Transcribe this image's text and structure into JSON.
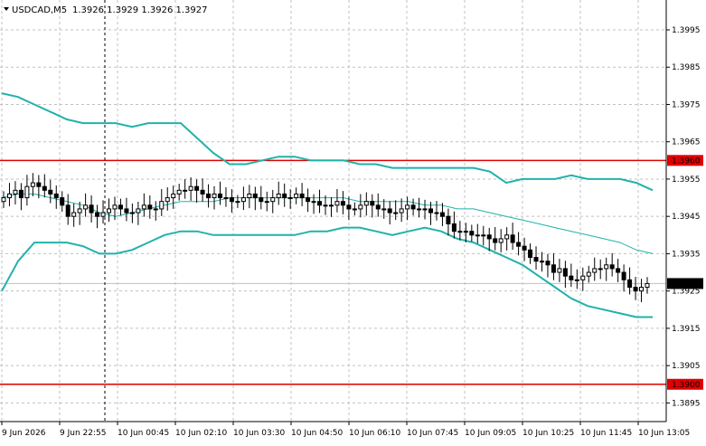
{
  "header": {
    "symbol_label": "USDCAD,M5",
    "ohlc_label": "1.3926 1.3929 1.3926 1.3927"
  },
  "colors": {
    "background": "#ffffff",
    "grid": "#c0c0c0",
    "axis": "#000000",
    "candle": "#000000",
    "bollinger": "#20b2aa",
    "level_line": "#e00000",
    "price_tag_bg": "#000000",
    "level_tag_bg": "#e00000",
    "tag_text": "#ffffff",
    "current_price_line": "#c0c0c0"
  },
  "chart_data": {
    "type": "candlestick",
    "title": "",
    "xlabel": "",
    "ylabel": "",
    "ylim": [
      1.389,
      1.4003
    ],
    "grid": true,
    "y_ticks": [
      "1.3995",
      "1.3985",
      "1.3975",
      "1.3965",
      "1.3955",
      "1.3945",
      "1.3935",
      "1.3925",
      "1.3915",
      "1.3905",
      "1.3895"
    ],
    "x_ticks": [
      "9 Jun 2026",
      "9 Jun 22:55",
      "10 Jun 00:45",
      "10 Jun 02:10",
      "10 Jun 03:30",
      "10 Jun 04:50",
      "10 Jun 06:10",
      "10 Jun 07:45",
      "10 Jun 09:05",
      "10 Jun 10:25",
      "10 Jun 11:45",
      "10 Jun 13:05"
    ],
    "levels": [
      {
        "label": "1.3960",
        "value": 1.396
      },
      {
        "label": "1.3900",
        "value": 1.39
      }
    ],
    "current_price": {
      "label": "1.3927",
      "value": 1.3927
    },
    "crosshair_x_time": "9 Jun 22:55",
    "close_series": [
      1.395,
      1.3951,
      1.3952,
      1.395,
      1.3953,
      1.3954,
      1.3953,
      1.3952,
      1.3951,
      1.395,
      1.3948,
      1.3945,
      1.3946,
      1.3947,
      1.3948,
      1.3946,
      1.3945,
      1.3946,
      1.3947,
      1.3948,
      1.3947,
      1.3946,
      1.3946,
      1.3947,
      1.3948,
      1.3947,
      1.3947,
      1.3949,
      1.395,
      1.3951,
      1.3952,
      1.3952,
      1.3953,
      1.3952,
      1.3951,
      1.395,
      1.3951,
      1.395,
      1.395,
      1.3949,
      1.3949,
      1.395,
      1.3951,
      1.395,
      1.3949,
      1.3949,
      1.395,
      1.3951,
      1.395,
      1.395,
      1.3951,
      1.395,
      1.3949,
      1.3949,
      1.3948,
      1.3948,
      1.3948,
      1.3949,
      1.3948,
      1.3947,
      1.3947,
      1.3948,
      1.3949,
      1.3948,
      1.3947,
      1.3947,
      1.3946,
      1.3946,
      1.3947,
      1.3948,
      1.3947,
      1.3947,
      1.3947,
      1.3946,
      1.3946,
      1.3945,
      1.3943,
      1.3941,
      1.3941,
      1.3941,
      1.394,
      1.394,
      1.394,
      1.3939,
      1.3938,
      1.3939,
      1.394,
      1.3938,
      1.3937,
      1.3936,
      1.3934,
      1.3933,
      1.3933,
      1.3932,
      1.393,
      1.3931,
      1.3929,
      1.3928,
      1.3928,
      1.3929,
      1.393,
      1.3931,
      1.3931,
      1.3932,
      1.3931,
      1.393,
      1.3928,
      1.3926,
      1.3925,
      1.3926,
      1.3927
    ],
    "series": [
      {
        "values": [
          1.3978,
          1.3977,
          1.3975,
          1.3973,
          1.3971,
          1.397,
          1.397,
          1.397,
          1.3969,
          1.397,
          1.397,
          1.397,
          1.3966,
          1.3962,
          1.3959,
          1.3959,
          1.396,
          1.3961,
          1.3961,
          1.396,
          1.396,
          1.396,
          1.3959,
          1.3959,
          1.3958,
          1.3958,
          1.3958,
          1.3958,
          1.3958,
          1.3958,
          1.3957,
          1.3954,
          1.3955,
          1.3955,
          1.3955,
          1.3956,
          1.3955,
          1.3955,
          1.3955,
          1.3954,
          1.3952
        ]
      },
      {
        "values": [
          1.395,
          1.3951,
          1.3951,
          1.395,
          1.3949,
          1.3948,
          1.3946,
          1.3945,
          1.3946,
          1.3947,
          1.3948,
          1.3949,
          1.3949,
          1.3949,
          1.395,
          1.395,
          1.395,
          1.395,
          1.395,
          1.395,
          1.395,
          1.395,
          1.3949,
          1.3949,
          1.3949,
          1.3949,
          1.3948,
          1.3948,
          1.3947,
          1.3947,
          1.3946,
          1.3945,
          1.3944,
          1.3943,
          1.3942,
          1.3941,
          1.394,
          1.3939,
          1.3938,
          1.3936,
          1.3935
        ]
      },
      {
        "values": [
          1.3925,
          1.3933,
          1.3938,
          1.3938,
          1.3938,
          1.3937,
          1.3935,
          1.3935,
          1.3936,
          1.3938,
          1.394,
          1.3941,
          1.3941,
          1.394,
          1.394,
          1.394,
          1.394,
          1.394,
          1.394,
          1.3941,
          1.3941,
          1.3942,
          1.3942,
          1.3941,
          1.394,
          1.3941,
          1.3942,
          1.3941,
          1.3939,
          1.3938,
          1.3936,
          1.3934,
          1.3932,
          1.3929,
          1.3926,
          1.3923,
          1.3921,
          1.392,
          1.3919,
          1.3918,
          1.3918
        ]
      }
    ]
  }
}
